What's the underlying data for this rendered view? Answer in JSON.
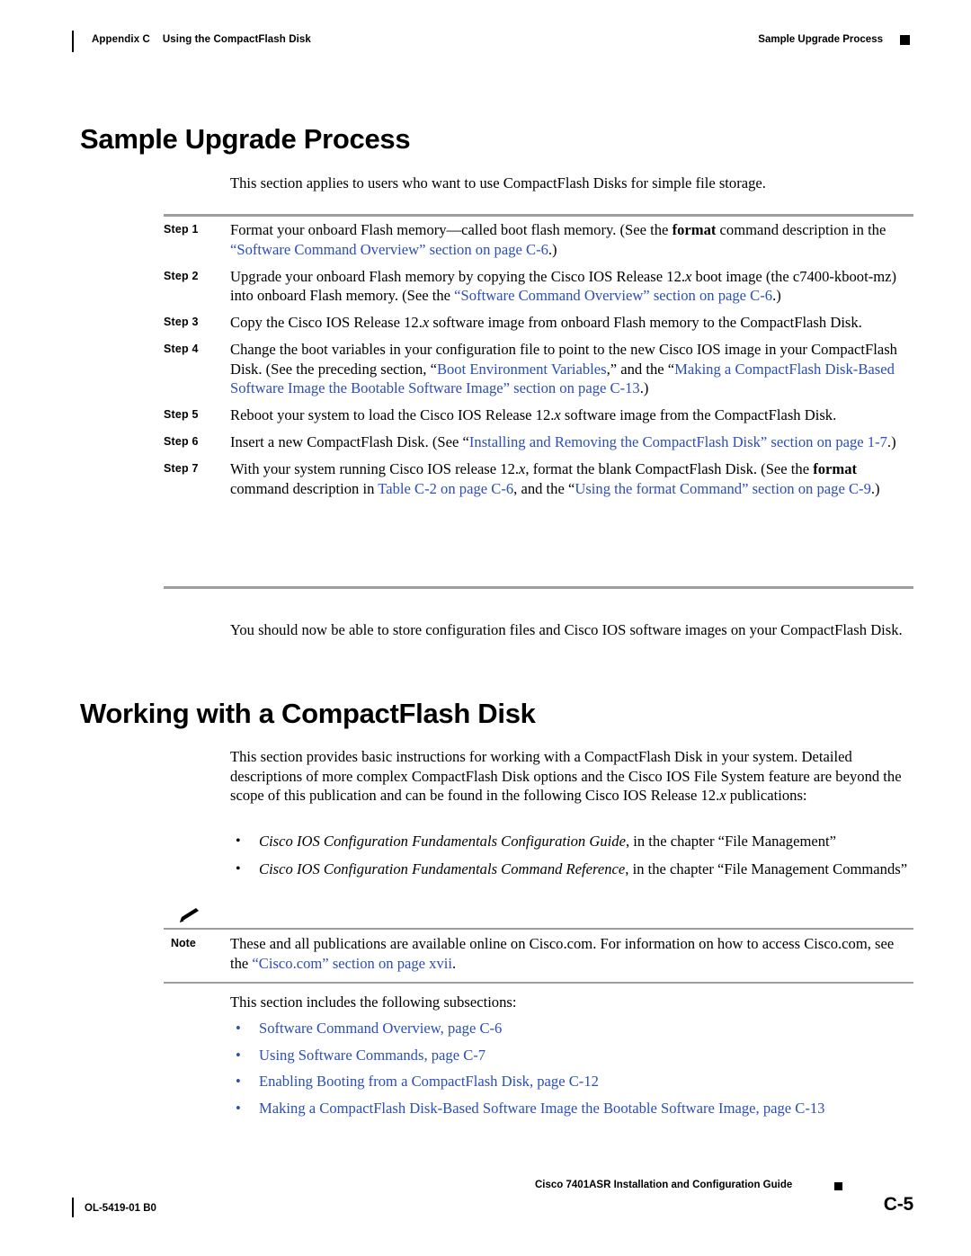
{
  "header": {
    "appendix": "Appendix C",
    "appendix_title": "Using the CompactFlash Disk",
    "running_head": "Sample Upgrade Process"
  },
  "sections": {
    "sample_upgrade": {
      "heading": "Sample Upgrade Process",
      "intro": "This section applies to users who want to use CompactFlash Disks for simple file storage.",
      "steps": [
        {
          "label": "Step 1",
          "parts": [
            {
              "t": "Format your onboard Flash memory—called boot flash memory. (See the ",
              "s": "plain"
            },
            {
              "t": "format",
              "s": "bold"
            },
            {
              "t": " command description in the ",
              "s": "plain"
            },
            {
              "t": "“Software Command Overview” section on page C-6",
              "s": "link"
            },
            {
              "t": ".)",
              "s": "plain"
            }
          ]
        },
        {
          "label": "Step 2",
          "parts": [
            {
              "t": "Upgrade your onboard Flash memory by copying the Cisco IOS Release 12.",
              "s": "plain"
            },
            {
              "t": "x",
              "s": "ital"
            },
            {
              "t": " boot image (the c7400-kboot-mz) into onboard Flash memory. (See the ",
              "s": "plain"
            },
            {
              "t": "“Software Command Overview” section on page C-6",
              "s": "link"
            },
            {
              "t": ".)",
              "s": "plain"
            }
          ]
        },
        {
          "label": "Step 3",
          "parts": [
            {
              "t": "Copy the Cisco IOS Release 12.",
              "s": "plain"
            },
            {
              "t": "x",
              "s": "ital"
            },
            {
              "t": " software image from onboard Flash memory to the CompactFlash Disk.",
              "s": "plain"
            }
          ]
        },
        {
          "label": "Step 4",
          "parts": [
            {
              "t": "Change the boot variables in your configuration file to point to the new Cisco IOS image in your CompactFlash Disk. (See the preceding section, “",
              "s": "plain"
            },
            {
              "t": "Boot Environment Variables",
              "s": "link"
            },
            {
              "t": ",” and the “",
              "s": "plain"
            },
            {
              "t": "Making a CompactFlash Disk-Based Software Image the Bootable Software Image” section on page C-13",
              "s": "link"
            },
            {
              "t": ".)",
              "s": "plain"
            }
          ]
        },
        {
          "label": "Step 5",
          "parts": [
            {
              "t": "Reboot your system to load the Cisco IOS Release 12.",
              "s": "plain"
            },
            {
              "t": "x",
              "s": "ital"
            },
            {
              "t": " software image from the CompactFlash Disk.",
              "s": "plain"
            }
          ]
        },
        {
          "label": "Step 6",
          "parts": [
            {
              "t": "Insert a new CompactFlash Disk. (See “",
              "s": "plain"
            },
            {
              "t": "Installing and Removing the CompactFlash Disk” section on page 1-7",
              "s": "link"
            },
            {
              "t": ".)",
              "s": "plain"
            }
          ]
        },
        {
          "label": "Step 7",
          "parts": [
            {
              "t": "With your system running Cisco IOS release 12.",
              "s": "plain"
            },
            {
              "t": "x",
              "s": "ital"
            },
            {
              "t": ", format the blank CompactFlash Disk. (See the ",
              "s": "plain"
            },
            {
              "t": "format",
              "s": "bold"
            },
            {
              "t": " command description in ",
              "s": "plain"
            },
            {
              "t": "Table C-2 on page C-6",
              "s": "link"
            },
            {
              "t": ", and the “",
              "s": "plain"
            },
            {
              "t": "Using the format Command” section on page C-9",
              "s": "link"
            },
            {
              "t": ".)",
              "s": "plain"
            }
          ]
        }
      ],
      "closing": "You should now be able to store configuration files and Cisco IOS software images on your CompactFlash Disk."
    },
    "working_with": {
      "heading": "Working with a CompactFlash Disk",
      "intro_parts": [
        {
          "t": "This section provides basic instructions for working with a CompactFlash Disk in your system. Detailed descriptions of more complex CompactFlash Disk options and the Cisco IOS File System feature are beyond the scope of this publication and can be found in the following Cisco IOS Release 12.",
          "s": "plain"
        },
        {
          "t": "x",
          "s": "ital"
        },
        {
          "t": " publications:",
          "s": "plain"
        }
      ],
      "publications": [
        [
          {
            "t": "Cisco IOS Configuration Fundamentals Configuration Guide",
            "s": "ital"
          },
          {
            "t": ", in the chapter “File Management”",
            "s": "plain"
          }
        ],
        [
          {
            "t": "Cisco IOS Configuration Fundamentals Command Reference",
            "s": "ital"
          },
          {
            "t": ", in the chapter “File Management Commands”",
            "s": "plain"
          }
        ]
      ],
      "note": {
        "label": "Note",
        "parts": [
          {
            "t": "These and all publications are available online on Cisco.com. For information on how to access Cisco.com, see the ",
            "s": "plain"
          },
          {
            "t": "“Cisco.com” section on page xvii",
            "s": "link"
          },
          {
            "t": ".",
            "s": "plain"
          }
        ]
      },
      "subsections_lead": "This section includes the following subsections:",
      "subsections": [
        "Software Command Overview, page C-6",
        "Using Software Commands, page C-7",
        "Enabling Booting from a CompactFlash Disk, page C-12",
        "Making a CompactFlash Disk-Based Software Image the Bootable Software Image, page C-13"
      ]
    }
  },
  "footer": {
    "doc_number": "OL-5419-01 B0",
    "guide_title": "Cisco 7401ASR Installation and Configuration Guide",
    "page_number": "C-5"
  },
  "colors": {
    "link": "#2b4eb8",
    "rule": "#9d9d9d",
    "text": "#000000"
  }
}
